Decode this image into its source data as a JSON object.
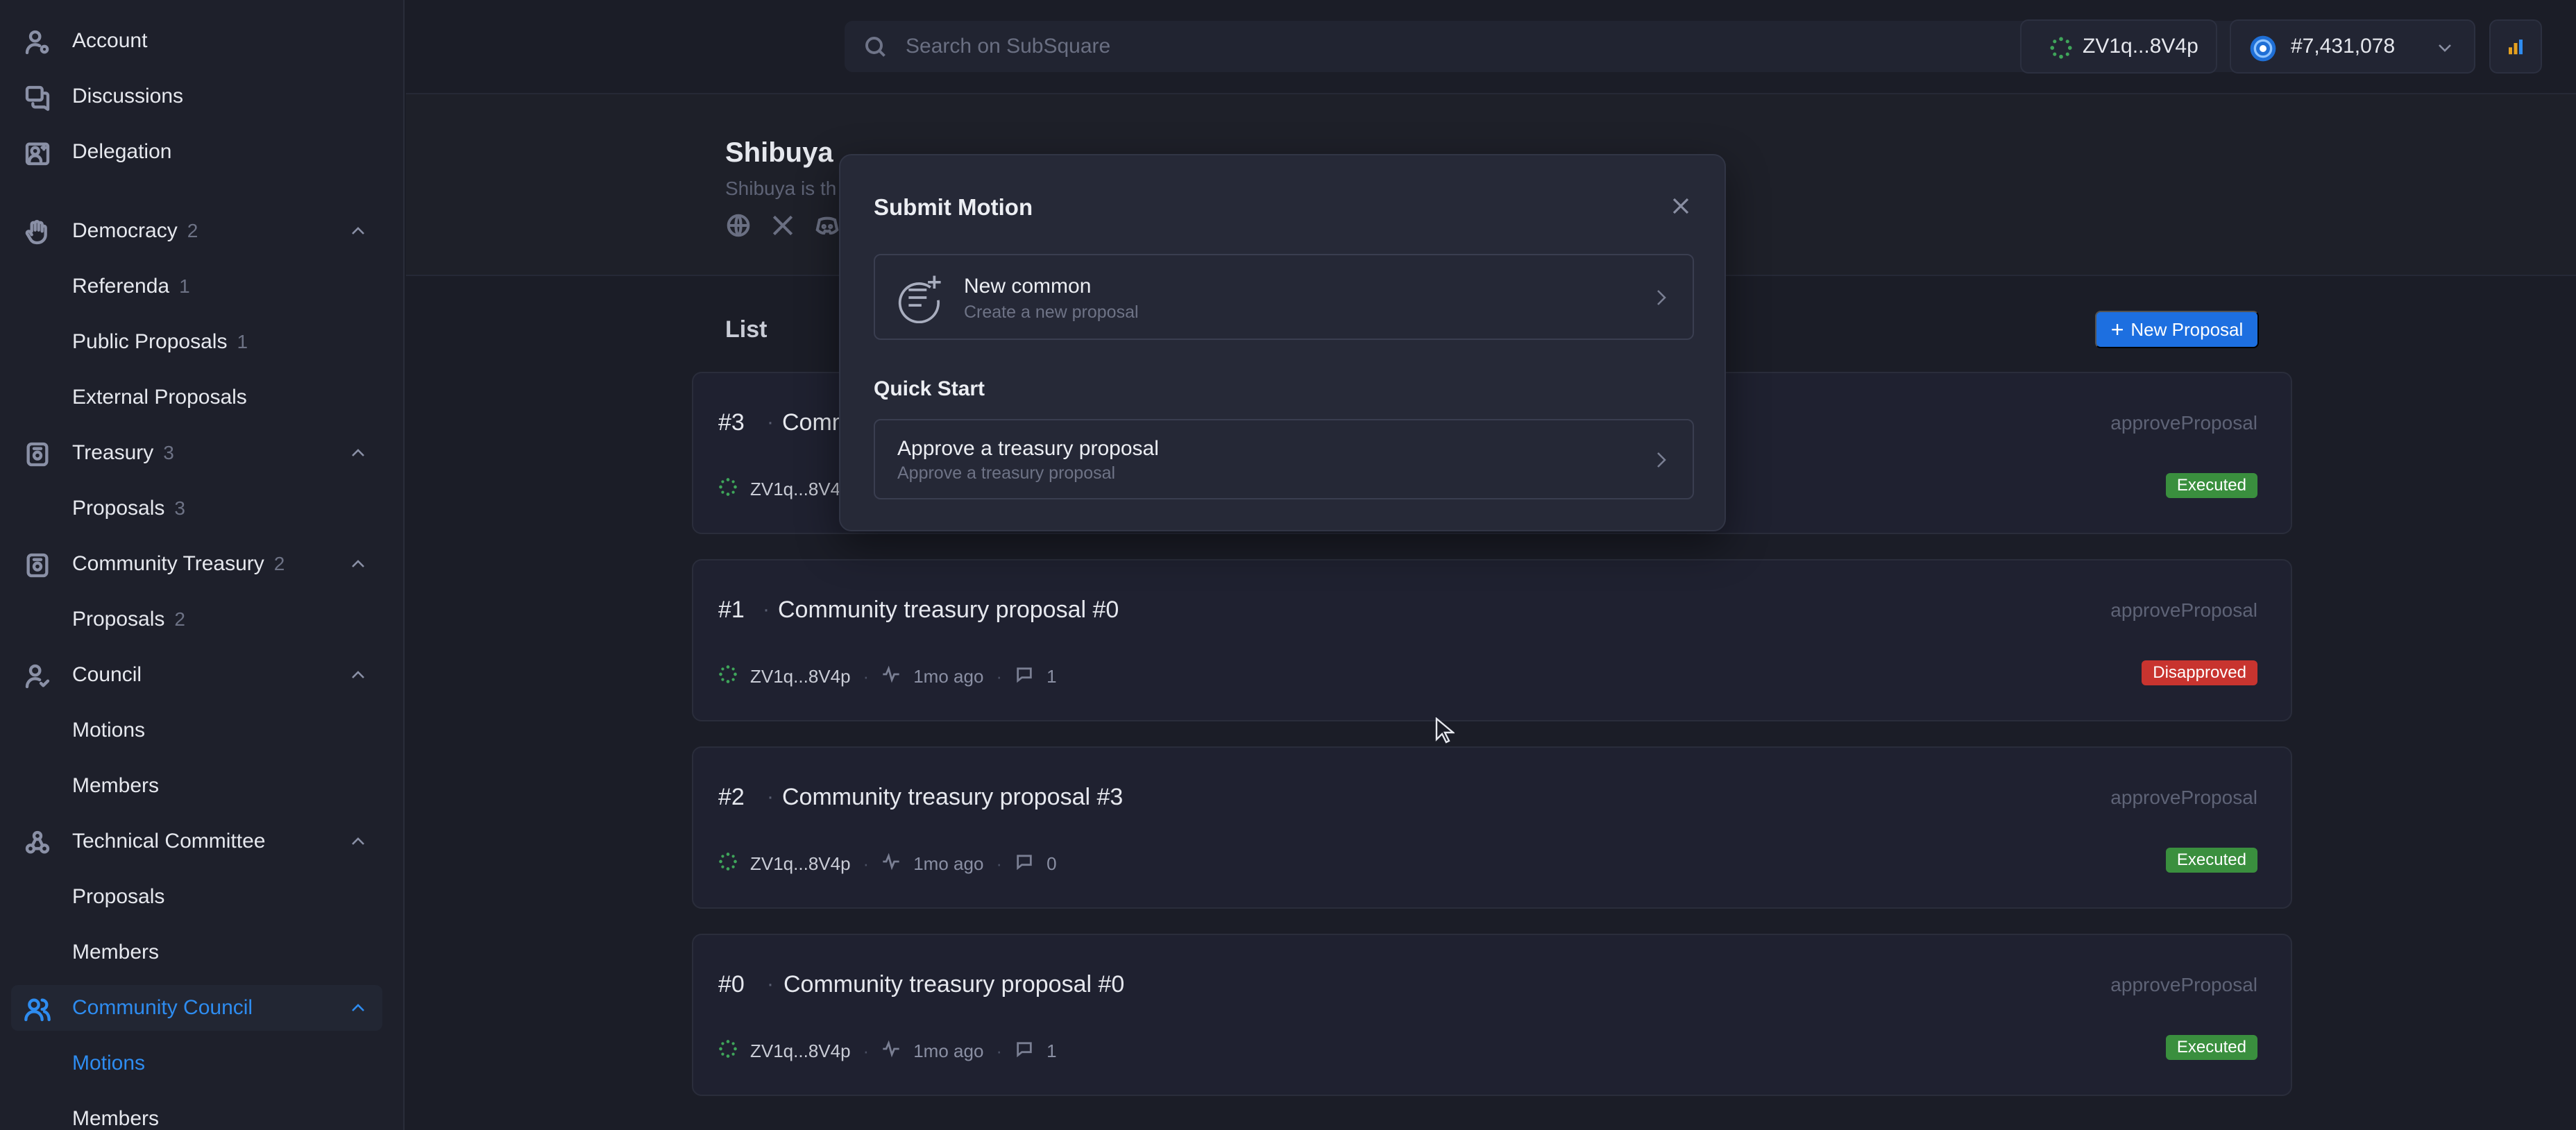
{
  "sidebar": {
    "account": "Account",
    "discussions": "Discussions",
    "delegation": "Delegation",
    "democracy": {
      "label": "Democracy",
      "count": "2"
    },
    "referenda": {
      "label": "Referenda",
      "count": "1"
    },
    "public_proposals": {
      "label": "Public Proposals",
      "count": "1"
    },
    "external_proposals": {
      "label": "External Proposals"
    },
    "treasury": {
      "label": "Treasury",
      "count": "3"
    },
    "treasury_proposals": {
      "label": "Proposals",
      "count": "3"
    },
    "community_treasury": {
      "label": "Community Treasury",
      "count": "2"
    },
    "community_treasury_proposals": {
      "label": "Proposals",
      "count": "2"
    },
    "council": {
      "label": "Council"
    },
    "council_motions": {
      "label": "Motions"
    },
    "council_members": {
      "label": "Members"
    },
    "technical_committee": {
      "label": "Technical Committee"
    },
    "tc_proposals": {
      "label": "Proposals"
    },
    "tc_members": {
      "label": "Members"
    },
    "community_council": {
      "label": "Community Council"
    },
    "cc_motions": {
      "label": "Motions"
    },
    "cc_members": {
      "label": "Members"
    }
  },
  "topbar": {
    "search_placeholder": "Search on SubSquare",
    "search_shortcut": "/",
    "account": "ZV1q...8V4p",
    "block": "#7,431,078"
  },
  "chain": {
    "title": "Shibuya",
    "desc": "Shibuya is th"
  },
  "list": {
    "title": "List",
    "new_proposal": "New Proposal",
    "items": [
      {
        "idx": "#3",
        "title": "Comm",
        "method": "approveProposal",
        "addr": "ZV1q...8V4",
        "status": "Executed",
        "status_color": "#3a8f3e"
      },
      {
        "idx": "#1",
        "title": "Community treasury proposal #0",
        "method": "approveProposal",
        "addr": "ZV1q...8V4p",
        "time": "1mo ago",
        "comments": "1",
        "status": "Disapproved",
        "status_color": "#c8342f"
      },
      {
        "idx": "#2",
        "title": "Community treasury proposal #3",
        "method": "approveProposal",
        "addr": "ZV1q...8V4p",
        "time": "1mo ago",
        "comments": "0",
        "status": "Executed",
        "status_color": "#3a8f3e"
      },
      {
        "idx": "#0",
        "title": "Community treasury proposal #0",
        "method": "approveProposal",
        "addr": "ZV1q...8V4p",
        "time": "1mo ago",
        "comments": "1",
        "status": "Executed",
        "status_color": "#3a8f3e"
      }
    ]
  },
  "modal": {
    "title": "Submit Motion",
    "option1": {
      "title": "New common",
      "subtitle": "Create a new proposal"
    },
    "quick_start": "Quick Start",
    "option2": {
      "title": "Approve a treasury proposal",
      "subtitle": "Approve a treasury proposal"
    }
  },
  "colors": {
    "accent": "#2e8cf0",
    "button": "#1d6fe0",
    "executed": "#3a8f3e",
    "disapproved": "#c8342f"
  }
}
